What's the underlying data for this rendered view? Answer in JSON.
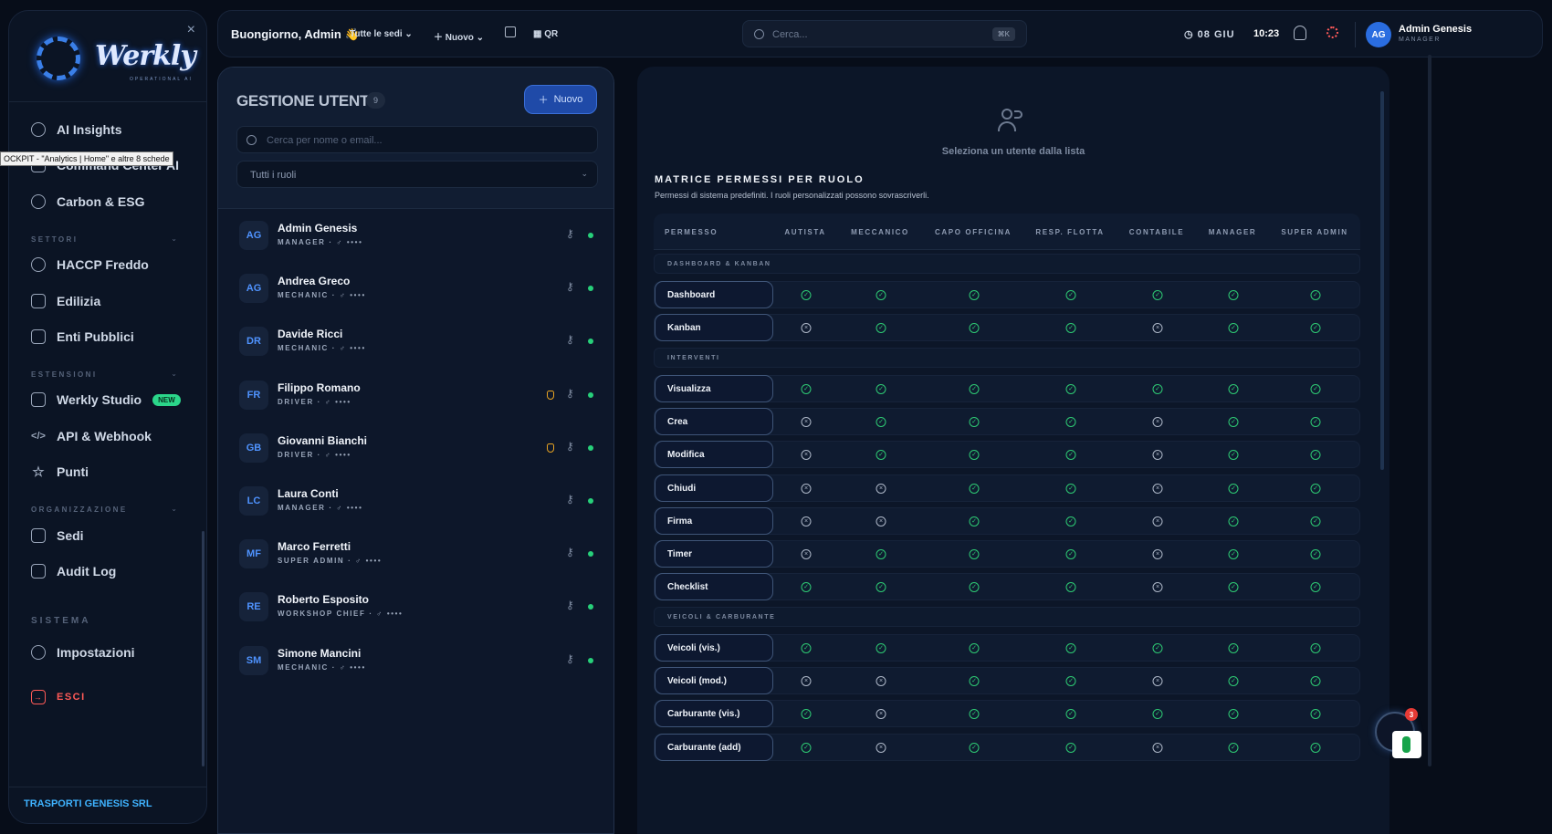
{
  "sidebar": {
    "logo_text": "Werkly",
    "logo_sub": "OPERATIONAL AI",
    "close": "×",
    "tooltip": "OCKPIT - \"Analytics | Home\" e altre 8 schede",
    "sections": {
      "settori": "SETTORI",
      "estensioni": "ESTENSIONI",
      "organizzazione": "ORGANIZZAZIONE",
      "sistema": "SISTEMA"
    },
    "items": {
      "ai_insights": "AI Insights",
      "command_center": "Command Center AI",
      "carbon": "Carbon & ESG",
      "haccp": "HACCP Freddo",
      "edilizia": "Edilizia",
      "enti": "Enti Pubblici",
      "studio": "Werkly Studio",
      "studio_badge": "NEW",
      "api": "API & Webhook",
      "punti": "Punti",
      "sedi": "Sedi",
      "audit": "Audit Log",
      "impostazioni": "Impostazioni",
      "esci": "ESCI"
    },
    "company": "TRASPORTI GENESIS SRL"
  },
  "topbar": {
    "greeting": "Buongiorno, Admin 👋",
    "sites": "Tutte le sedi",
    "new": "Nuovo",
    "qr": "QR",
    "search_placeholder": "Cerca...",
    "shortcut": "⌘K",
    "date": "08 GIU",
    "time": "10:23",
    "avatar": "AG",
    "user_name": "Admin Genesis",
    "user_role": "MANAGER"
  },
  "users": {
    "title": "GESTIONE UTENTI",
    "count": "9",
    "new_label": "Nuovo",
    "search_placeholder": "Cerca per nome o email...",
    "role_filter": "Tutti i ruoli",
    "list": [
      {
        "initials": "AG",
        "name": "Admin Genesis",
        "role": "MANAGER",
        "meta": "·  ♂ ••••",
        "shield": false
      },
      {
        "initials": "AG",
        "name": "Andrea Greco",
        "role": "MECHANIC",
        "meta": "·  ♂ ••••",
        "shield": false
      },
      {
        "initials": "DR",
        "name": "Davide Ricci",
        "role": "MECHANIC",
        "meta": "·  ♂ ••••",
        "shield": false
      },
      {
        "initials": "FR",
        "name": "Filippo Romano",
        "role": "DRIVER",
        "meta": "·  ♂ ••••",
        "shield": true
      },
      {
        "initials": "GB",
        "name": "Giovanni Bianchi",
        "role": "DRIVER",
        "meta": "·  ♂ ••••",
        "shield": true
      },
      {
        "initials": "LC",
        "name": "Laura Conti",
        "role": "MANAGER",
        "meta": "·  ♂ ••••",
        "shield": false
      },
      {
        "initials": "MF",
        "name": "Marco Ferretti",
        "role": "SUPER ADMIN",
        "meta": "·  ♂ ••••",
        "shield": false
      },
      {
        "initials": "RE",
        "name": "Roberto Esposito",
        "role": "WORKSHOP CHIEF",
        "meta": "·  ♂ ••••",
        "shield": false
      },
      {
        "initials": "SM",
        "name": "Simone Mancini",
        "role": "MECHANIC",
        "meta": "·  ♂ ••••",
        "shield": false
      }
    ]
  },
  "matrix": {
    "empty_text": "Seleziona un utente dalla lista",
    "title": "MATRICE PERMESSI PER RUOLO",
    "subtitle": "Permessi di sistema predefiniti. I ruoli personalizzati possono sovrascriverli.",
    "columns": [
      "PERMESSO",
      "AUTISTA",
      "MECCANICO",
      "CAPO OFFICINA",
      "RESP. FLOTTA",
      "CONTABILE",
      "MANAGER",
      "SUPER ADMIN"
    ],
    "rows": [
      {
        "group": "DASHBOARD & KANBAN"
      },
      {
        "label": "Dashboard",
        "perms": [
          1,
          1,
          1,
          1,
          1,
          1,
          1
        ]
      },
      {
        "label": "Kanban",
        "perms": [
          0,
          1,
          1,
          1,
          0,
          1,
          1
        ]
      },
      {
        "group": "INTERVENTI"
      },
      {
        "label": "Visualizza",
        "perms": [
          1,
          1,
          1,
          1,
          1,
          1,
          1
        ]
      },
      {
        "label": "Crea",
        "perms": [
          0,
          1,
          1,
          1,
          0,
          1,
          1
        ]
      },
      {
        "label": "Modifica",
        "perms": [
          0,
          1,
          1,
          1,
          0,
          1,
          1
        ]
      },
      {
        "label": "Chiudi",
        "perms": [
          0,
          0,
          1,
          1,
          0,
          1,
          1
        ]
      },
      {
        "label": "Firma",
        "perms": [
          0,
          0,
          1,
          1,
          0,
          1,
          1
        ]
      },
      {
        "label": "Timer",
        "perms": [
          0,
          1,
          1,
          1,
          0,
          1,
          1
        ]
      },
      {
        "label": "Checklist",
        "perms": [
          1,
          1,
          1,
          1,
          0,
          1,
          1
        ]
      },
      {
        "group": "VEICOLI & CARBURANTE"
      },
      {
        "label": "Veicoli (vis.)",
        "perms": [
          1,
          1,
          1,
          1,
          1,
          1,
          1
        ]
      },
      {
        "label": "Veicoli (mod.)",
        "perms": [
          0,
          0,
          1,
          1,
          0,
          1,
          1
        ]
      },
      {
        "label": "Carburante (vis.)",
        "perms": [
          1,
          0,
          1,
          1,
          1,
          1,
          1
        ]
      },
      {
        "label": "Carburante (add)",
        "perms": [
          1,
          0,
          1,
          1,
          0,
          1,
          1
        ]
      }
    ]
  },
  "fab_badge": "3"
}
